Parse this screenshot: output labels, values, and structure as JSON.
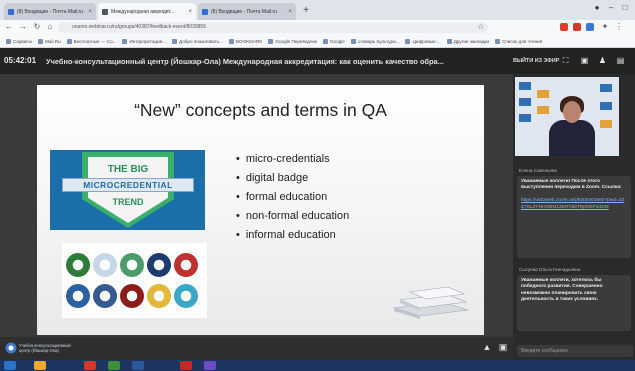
{
  "browser": {
    "tabs": [
      {
        "label": "(8) Входящие - Почта Mail.ru",
        "active": false
      },
      {
        "label": "Международная аккредит...",
        "active": true
      },
      {
        "label": "(8) Входящие - Почта Mail.ru",
        "active": false
      }
    ],
    "new_tab": "+",
    "url": "unamo.webinar.ru/ru/groups/40387/feedback-event/8030855",
    "bookmarks": [
      "Сервисы",
      "Mail.Ru",
      "Бесплатные — Co...",
      "Интерпретация...",
      "Добро пожаловать...",
      "BOOKMARK",
      "Google Переводчик",
      "Google",
      "словарь Культура...",
      "Цифровые ...",
      "Другие закладки",
      "Список для чтения"
    ]
  },
  "meeting": {
    "time": "05:42:01",
    "title": "Учебно-консультационный центр (Йошкар-Ола)   Международная аккредитация: как оценить качество обра...",
    "exit_label": "ВЫЙТИ ИЗ ЭФИР"
  },
  "slide": {
    "title": "“New” concepts and terms in QA",
    "badge": {
      "line1": "THE BIG",
      "line2": "MICROCREDENTIAL",
      "line3": "TREND"
    },
    "bullets": [
      "micro-credentials",
      "digital badge",
      "formal education",
      "non-formal education",
      "informal education"
    ],
    "logo_colors": [
      "#2f7c3a",
      "#c8d7e6",
      "#4c9b6a",
      "#1d3b6e",
      "#c0302f",
      "#2b5fa0",
      "#355a8f",
      "#8b1d1d",
      "#e0b83a",
      "#3aa7c9"
    ]
  },
  "chat": {
    "messages": [
      {
        "author": "Елена Савельева",
        "text": "Уважаемые коллеги! После этого выступления переходим в Zoom. Ссылка:",
        "link": "https://us02web.zoom.us/j/8300401560?pwd=Z2Z7SLZYNHOBM1ZMThlMTRpOEFndz09"
      },
      {
        "author": "Сысуева Ольга Геннадьевна",
        "text": "Уважаемые коллеги, хотелось бы победного развития. Совершенно невозможно планировать свою деятельность в таких условиях.",
        "link": ""
      }
    ],
    "input_placeholder": "Введите сообщение"
  },
  "org": {
    "name": "Учебно-консультационный центр (Йошкар-Ола)"
  },
  "taskbar": {
    "icons": [
      "start-icon",
      "search-icon",
      "chrome-icon",
      "explorer-icon",
      "word-icon",
      "pdf-icon",
      "app-icon"
    ],
    "colors": [
      "#2b72c9",
      "#f0a830",
      "#d33a2c",
      "#3f8f3a",
      "#2b579a",
      "#c62828",
      "#6b4cc2"
    ]
  }
}
